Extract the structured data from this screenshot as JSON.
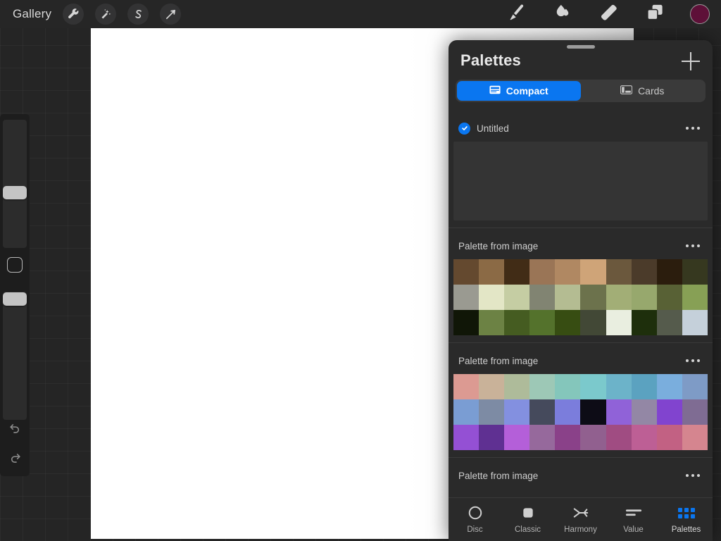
{
  "app": {
    "toolbar_left": [
      {
        "name": "gallery",
        "label": "Gallery",
        "type": "text"
      },
      {
        "name": "actions",
        "label": "Actions",
        "icon": "wrench-icon"
      },
      {
        "name": "adjustments",
        "label": "Adjustments",
        "icon": "magic-wand-icon"
      },
      {
        "name": "selection",
        "label": "Selection",
        "icon": "s-curve-icon"
      },
      {
        "name": "transform",
        "label": "Transform",
        "icon": "arrow-cursor-icon"
      }
    ],
    "toolbar_right": [
      {
        "name": "paint",
        "label": "Paint",
        "icon": "paintbrush-icon"
      },
      {
        "name": "smudge",
        "label": "Smudge",
        "icon": "smudge-icon"
      },
      {
        "name": "erase",
        "label": "Erase",
        "icon": "eraser-icon"
      },
      {
        "name": "layers",
        "label": "Layers",
        "icon": "layers-icon"
      },
      {
        "name": "color",
        "label": "Color",
        "icon": "color-swatch-icon",
        "color": "#5e1038"
      }
    ]
  },
  "sidebar": {
    "brush_size_label": "Brush size",
    "opacity_label": "Opacity",
    "modify_label": "Modify",
    "undo_label": "Undo",
    "redo_label": "Redo"
  },
  "panel": {
    "title": "Palettes",
    "add_label": "+",
    "view_modes": [
      {
        "label": "Compact",
        "icon": "compact-view-icon",
        "active": true
      },
      {
        "label": "Cards",
        "icon": "cards-view-icon",
        "active": false
      }
    ],
    "palettes": [
      {
        "name": "Untitled",
        "selected": true,
        "menu_label": "•••",
        "rows": []
      },
      {
        "name": "Palette from image",
        "selected": false,
        "menu_label": "•••",
        "rows": [
          [
            "#64492f",
            "#8b6a45",
            "#412c16",
            "#9a7556",
            "#b08862",
            "#cfa478",
            "#6b583d",
            "#4b3b2a",
            "#2b1d0d",
            "#36381f"
          ],
          [
            "#9a9a91",
            "#e3e6c6",
            "#c5cda3",
            "#818472",
            "#b4bc92",
            "#6c724c",
            "#a2ae76",
            "#97a86d",
            "#586135",
            "#87a055"
          ],
          [
            "#101607",
            "#6c8244",
            "#455c21",
            "#54722c",
            "#374d12",
            "#424836",
            "#e9eee0",
            "#1e2f0c",
            "#555b4c",
            "#c5d0da"
          ]
        ]
      },
      {
        "name": "Palette from image",
        "selected": false,
        "menu_label": "•••",
        "rows": [
          [
            "#dc9a92",
            "#c9b299",
            "#aebb9a",
            "#9dc8b6",
            "#84c6bb",
            "#7bc9cc",
            "#6cb3c9",
            "#5ba2c0",
            "#7aaedd",
            "#7e9bc6"
          ],
          [
            "#7a9dd3",
            "#7d8ba4",
            "#8390e0",
            "#454a5c",
            "#7b7ddc",
            "#0d0c16",
            "#9062d8",
            "#9387a5",
            "#8144cf",
            "#7f6c93"
          ],
          [
            "#9450d4",
            "#5f3092",
            "#b45fd9",
            "#96699c",
            "#8a4189",
            "#91608f",
            "#a04c82",
            "#bd5f95",
            "#c26183",
            "#d5858f"
          ]
        ]
      },
      {
        "name": "Palette from image",
        "selected": false,
        "menu_label": "•••",
        "rows": []
      }
    ]
  },
  "tabs": [
    {
      "label": "Disc",
      "icon": "disc-icon",
      "active": false
    },
    {
      "label": "Classic",
      "icon": "classic-square-icon",
      "active": false
    },
    {
      "label": "Harmony",
      "icon": "harmony-icon",
      "active": false
    },
    {
      "label": "Value",
      "icon": "value-bars-icon",
      "active": false
    },
    {
      "label": "Palettes",
      "icon": "palettes-grid-icon",
      "active": true
    }
  ]
}
